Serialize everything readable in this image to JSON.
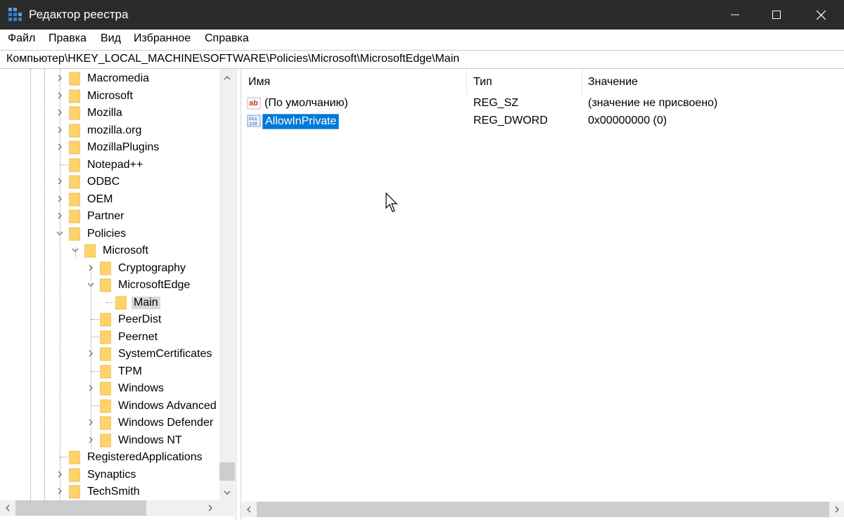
{
  "window": {
    "title": "Редактор реестра",
    "icon": "regedit-icon"
  },
  "menu": [
    "Файл",
    "Правка",
    "Вид",
    "Избранное",
    "Справка"
  ],
  "address": "Компьютер\\HKEY_LOCAL_MACHINE\\SOFTWARE\\Policies\\Microsoft\\MicrosoftEdge\\Main",
  "tree": [
    {
      "label": "Macromedia",
      "expander": "collapsed"
    },
    {
      "label": "Microsoft",
      "expander": "collapsed"
    },
    {
      "label": "Mozilla",
      "expander": "collapsed"
    },
    {
      "label": "mozilla.org",
      "expander": "collapsed"
    },
    {
      "label": "MozillaPlugins",
      "expander": "collapsed"
    },
    {
      "label": "Notepad++",
      "expander": "none"
    },
    {
      "label": "ODBC",
      "expander": "collapsed"
    },
    {
      "label": "OEM",
      "expander": "collapsed"
    },
    {
      "label": "Partner",
      "expander": "collapsed"
    },
    {
      "label": "Policies",
      "expander": "expanded"
    },
    {
      "label": "Microsoft",
      "expander": "expanded"
    },
    {
      "label": "Cryptography",
      "expander": "collapsed"
    },
    {
      "label": "MicrosoftEdge",
      "expander": "expanded"
    },
    {
      "label": "Main",
      "expander": "none",
      "selected": true
    },
    {
      "label": "PeerDist",
      "expander": "none"
    },
    {
      "label": "Peernet",
      "expander": "none"
    },
    {
      "label": "SystemCertificates",
      "expander": "collapsed"
    },
    {
      "label": "TPM",
      "expander": "none"
    },
    {
      "label": "Windows",
      "expander": "collapsed"
    },
    {
      "label": "Windows Advanced",
      "expander": "none"
    },
    {
      "label": "Windows Defender",
      "expander": "collapsed"
    },
    {
      "label": "Windows NT",
      "expander": "collapsed"
    },
    {
      "label": "RegisteredApplications",
      "expander": "none"
    },
    {
      "label": "Synaptics",
      "expander": "collapsed"
    },
    {
      "label": "TechSmith",
      "expander": "collapsed"
    }
  ],
  "columns": {
    "name": "Имя",
    "type": "Тип",
    "data": "Значение"
  },
  "values": [
    {
      "name": "(По умолчанию)",
      "type": "REG_SZ",
      "data": "(значение не присвоено)",
      "icon": "string-value-icon",
      "selected": false
    },
    {
      "name": "AllowInPrivate",
      "type": "REG_DWORD",
      "data": "0x00000000 (0)",
      "icon": "binary-value-icon",
      "selected": true
    }
  ],
  "colors": {
    "titlebar": "#2b2b2b",
    "selection": "#0078d7",
    "folder": "#ffd26b"
  }
}
